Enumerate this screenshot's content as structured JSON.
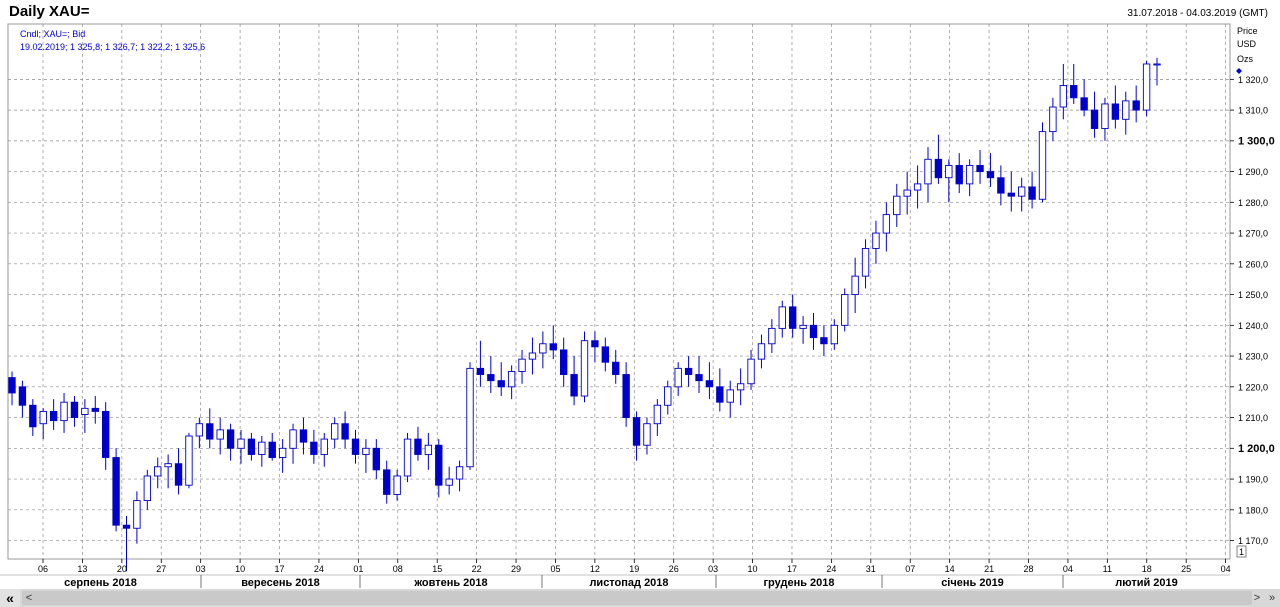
{
  "title": "Daily XAU=",
  "date_range": "31.07.2018 - 04.03.2019 (GMT)",
  "legend": {
    "line1": "Cndl; XAU=; Bid",
    "line2": "19.02.2019; 1 325,8; 1 326,7; 1 322,2; 1 325,6"
  },
  "axis_header": [
    "Price",
    "USD",
    "Ozs"
  ],
  "bottom_right_label": "1",
  "colors": {
    "accent": "#0000cc",
    "grid": "#8c8c8c",
    "up_fill": "#ffffff",
    "down_fill": "#0000cc"
  },
  "scrollbar": {
    "left_icon": "double-chevron-left-icon",
    "left_symbol": "«",
    "right_symbol": "<"
  },
  "chart_data": {
    "type": "candlestick",
    "y_tick_labels": [
      "1 170,0",
      "1 180,0",
      "1 190,0",
      "1 200,0",
      "1 210,0",
      "1 220,0",
      "1 230,0",
      "1 240,0",
      "1 250,0",
      "1 260,0",
      "1 270,0",
      "1 280,0",
      "1 290,0",
      "1 300,0",
      "1 310,0",
      "1 320,0"
    ],
    "y_ticks": [
      1170,
      1180,
      1190,
      1200,
      1210,
      1220,
      1230,
      1240,
      1250,
      1260,
      1270,
      1280,
      1290,
      1300,
      1310,
      1320
    ],
    "y_bold": [
      1200,
      1300
    ],
    "ylim": [
      1164,
      1338
    ],
    "x_tick_labels": [
      "06",
      "13",
      "20",
      "27",
      "03",
      "10",
      "17",
      "24",
      "01",
      "08",
      "15",
      "22",
      "29",
      "05",
      "12",
      "19",
      "26",
      "03",
      "10",
      "17",
      "24",
      "31",
      "07",
      "14",
      "21",
      "28",
      "04",
      "11",
      "18",
      "25",
      "04"
    ],
    "months": [
      "серпень 2018",
      "вересень 2018",
      "жовтень 2018",
      "листопад 2018",
      "грудень 2018",
      "січень 2019",
      "лютий 2019"
    ],
    "grid": true,
    "candles": [
      [
        1223,
        1225,
        1214,
        1218
      ],
      [
        1220,
        1222,
        1210,
        1214
      ],
      [
        1214,
        1216,
        1204,
        1207
      ],
      [
        1208,
        1213,
        1203,
        1212
      ],
      [
        1212,
        1216,
        1206,
        1209
      ],
      [
        1209,
        1218,
        1205,
        1215
      ],
      [
        1215,
        1217,
        1207,
        1210
      ],
      [
        1211,
        1216,
        1205,
        1213
      ],
      [
        1213,
        1217,
        1208,
        1212
      ],
      [
        1212,
        1215,
        1193,
        1197
      ],
      [
        1197,
        1200,
        1173,
        1175
      ],
      [
        1175,
        1178,
        1160,
        1174
      ],
      [
        1174,
        1186,
        1169,
        1183
      ],
      [
        1183,
        1193,
        1180,
        1191
      ],
      [
        1191,
        1197,
        1187,
        1194
      ],
      [
        1194,
        1198,
        1187,
        1195
      ],
      [
        1195,
        1200,
        1185,
        1188
      ],
      [
        1188,
        1205,
        1187,
        1204
      ],
      [
        1204,
        1210,
        1200,
        1208
      ],
      [
        1208,
        1213,
        1200,
        1203
      ],
      [
        1203,
        1210,
        1198,
        1206
      ],
      [
        1206,
        1208,
        1196,
        1200
      ],
      [
        1200,
        1206,
        1195,
        1203
      ],
      [
        1203,
        1205,
        1196,
        1198
      ],
      [
        1198,
        1204,
        1194,
        1202
      ],
      [
        1202,
        1205,
        1196,
        1197
      ],
      [
        1197,
        1203,
        1192,
        1200
      ],
      [
        1200,
        1208,
        1195,
        1206
      ],
      [
        1206,
        1210,
        1198,
        1202
      ],
      [
        1202,
        1206,
        1195,
        1198
      ],
      [
        1198,
        1205,
        1194,
        1203
      ],
      [
        1203,
        1210,
        1200,
        1208
      ],
      [
        1208,
        1212,
        1200,
        1203
      ],
      [
        1203,
        1206,
        1195,
        1198
      ],
      [
        1198,
        1203,
        1192,
        1200
      ],
      [
        1200,
        1203,
        1190,
        1193
      ],
      [
        1193,
        1196,
        1182,
        1185
      ],
      [
        1185,
        1193,
        1183,
        1191
      ],
      [
        1191,
        1205,
        1189,
        1203
      ],
      [
        1203,
        1207,
        1196,
        1198
      ],
      [
        1198,
        1205,
        1193,
        1201
      ],
      [
        1201,
        1203,
        1184,
        1188
      ],
      [
        1188,
        1194,
        1185,
        1190
      ],
      [
        1190,
        1196,
        1186,
        1194
      ],
      [
        1194,
        1228,
        1193,
        1226
      ],
      [
        1226,
        1235,
        1220,
        1224
      ],
      [
        1224,
        1230,
        1218,
        1222
      ],
      [
        1222,
        1228,
        1217,
        1220
      ],
      [
        1220,
        1227,
        1216,
        1225
      ],
      [
        1225,
        1232,
        1221,
        1229
      ],
      [
        1229,
        1236,
        1224,
        1231
      ],
      [
        1231,
        1238,
        1226,
        1234
      ],
      [
        1234,
        1240,
        1229,
        1232
      ],
      [
        1232,
        1236,
        1220,
        1224
      ],
      [
        1224,
        1230,
        1214,
        1217
      ],
      [
        1217,
        1238,
        1215,
        1235
      ],
      [
        1235,
        1238,
        1228,
        1233
      ],
      [
        1233,
        1236,
        1225,
        1228
      ],
      [
        1228,
        1232,
        1221,
        1224
      ],
      [
        1224,
        1228,
        1207,
        1210
      ],
      [
        1210,
        1212,
        1196,
        1201
      ],
      [
        1201,
        1210,
        1198,
        1208
      ],
      [
        1208,
        1216,
        1204,
        1214
      ],
      [
        1214,
        1222,
        1211,
        1220
      ],
      [
        1220,
        1228,
        1217,
        1226
      ],
      [
        1226,
        1230,
        1220,
        1224
      ],
      [
        1224,
        1230,
        1218,
        1222
      ],
      [
        1222,
        1228,
        1216,
        1220
      ],
      [
        1220,
        1226,
        1212,
        1215
      ],
      [
        1215,
        1222,
        1210,
        1219
      ],
      [
        1219,
        1226,
        1214,
        1221
      ],
      [
        1221,
        1232,
        1219,
        1229
      ],
      [
        1229,
        1237,
        1226,
        1234
      ],
      [
        1234,
        1242,
        1231,
        1239
      ],
      [
        1239,
        1248,
        1236,
        1246
      ],
      [
        1246,
        1250,
        1236,
        1239
      ],
      [
        1239,
        1243,
        1234,
        1240
      ],
      [
        1240,
        1244,
        1232,
        1236
      ],
      [
        1236,
        1240,
        1230,
        1234
      ],
      [
        1234,
        1242,
        1232,
        1240
      ],
      [
        1240,
        1252,
        1238,
        1250
      ],
      [
        1250,
        1262,
        1244,
        1256
      ],
      [
        1256,
        1268,
        1252,
        1265
      ],
      [
        1265,
        1274,
        1260,
        1270
      ],
      [
        1270,
        1280,
        1264,
        1276
      ],
      [
        1276,
        1286,
        1272,
        1282
      ],
      [
        1282,
        1290,
        1276,
        1284
      ],
      [
        1284,
        1292,
        1278,
        1286
      ],
      [
        1286,
        1298,
        1280,
        1294
      ],
      [
        1294,
        1302,
        1286,
        1288
      ],
      [
        1288,
        1294,
        1280,
        1292
      ],
      [
        1292,
        1296,
        1283,
        1286
      ],
      [
        1286,
        1294,
        1282,
        1292
      ],
      [
        1292,
        1297,
        1286,
        1290
      ],
      [
        1290,
        1296,
        1285,
        1288
      ],
      [
        1288,
        1292,
        1279,
        1283
      ],
      [
        1283,
        1290,
        1277,
        1282
      ],
      [
        1282,
        1288,
        1277,
        1285
      ],
      [
        1285,
        1290,
        1278,
        1281
      ],
      [
        1281,
        1306,
        1280,
        1303
      ],
      [
        1303,
        1314,
        1300,
        1311
      ],
      [
        1311,
        1325,
        1307,
        1318
      ],
      [
        1318,
        1325,
        1312,
        1314
      ],
      [
        1314,
        1320,
        1308,
        1310
      ],
      [
        1310,
        1316,
        1301,
        1304
      ],
      [
        1304,
        1314,
        1300,
        1312
      ],
      [
        1312,
        1318,
        1304,
        1307
      ],
      [
        1307,
        1316,
        1302,
        1313
      ],
      [
        1313,
        1318,
        1306,
        1310
      ],
      [
        1310,
        1326,
        1308,
        1325
      ],
      [
        1325,
        1327,
        1318,
        1325
      ]
    ]
  }
}
